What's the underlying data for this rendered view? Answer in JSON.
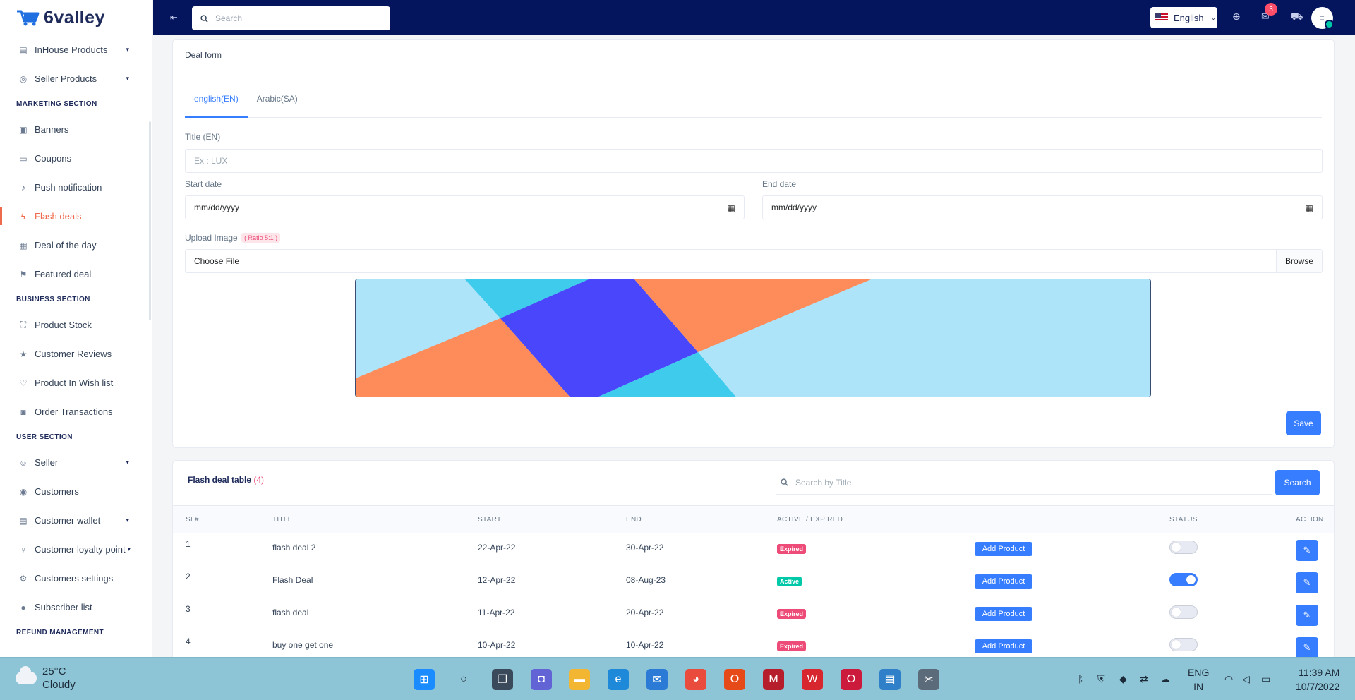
{
  "brand": {
    "name": "6valley"
  },
  "sidebar": {
    "items": [
      {
        "label": "InHouse Products",
        "icon": "store-icon",
        "caret": "▾"
      },
      {
        "label": "Seller Products",
        "icon": "seller-products-icon",
        "caret": "▾"
      },
      {
        "section": "MARKETING SECTION"
      },
      {
        "label": "Banners",
        "icon": "image-icon"
      },
      {
        "label": "Coupons",
        "icon": "coupon-icon"
      },
      {
        "label": "Push notification",
        "icon": "bell-icon"
      },
      {
        "label": "Flash deals",
        "icon": "flash-icon",
        "active": true
      },
      {
        "label": "Deal of the day",
        "icon": "deal-icon"
      },
      {
        "label": "Featured deal",
        "icon": "flag-icon"
      },
      {
        "section": "BUSINESS SECTION"
      },
      {
        "label": "Product Stock",
        "icon": "stock-icon"
      },
      {
        "label": "Customer Reviews",
        "icon": "star-icon"
      },
      {
        "label": "Product In Wish list",
        "icon": "heart-icon"
      },
      {
        "label": "Order Transactions",
        "icon": "money-icon"
      },
      {
        "section": "USER SECTION"
      },
      {
        "label": "Seller",
        "icon": "users-icon",
        "caret": "▾"
      },
      {
        "label": "Customers",
        "icon": "customer-icon"
      },
      {
        "label": "Customer wallet",
        "icon": "wallet-icon",
        "caret": "▾"
      },
      {
        "label": "Customer loyalty point",
        "icon": "bulb-icon",
        "caret": "▾"
      },
      {
        "label": "Customers settings",
        "icon": "gear-icon"
      },
      {
        "label": "Subscriber list",
        "icon": "person-icon"
      },
      {
        "section": "REFUND MANAGEMENT"
      }
    ]
  },
  "topbar": {
    "search_placeholder": "Search",
    "language": "English",
    "message_count": "3"
  },
  "form": {
    "header": "Deal form",
    "tabs": [
      "english(EN)",
      "Arabic(SA)"
    ],
    "title_label": "Title (EN)",
    "title_placeholder": "Ex : LUX",
    "start_label": "Start date",
    "start_value": "mm/dd/yyyy",
    "end_label": "End date",
    "end_value": "mm/dd/yyyy",
    "upload_label": "Upload Image",
    "ratio": "( Ratio 5:1 )",
    "choose_file": "Choose File",
    "browse": "Browse",
    "save": "Save"
  },
  "table": {
    "title": "Flash deal table",
    "count": "(4)",
    "search_placeholder": "Search by Title",
    "search_button": "Search",
    "columns": [
      "SL#",
      "TITLE",
      "START",
      "END",
      "ACTIVE / EXPIRED",
      "STATUS",
      "ACTION"
    ],
    "add_product": "Add Product",
    "rows": [
      {
        "sl": "1",
        "title": "flash deal 2",
        "start": "22-Apr-22",
        "end": "30-Apr-22",
        "state": "Expired",
        "status_on": false
      },
      {
        "sl": "2",
        "title": "Flash Deal",
        "start": "12-Apr-22",
        "end": "08-Aug-23",
        "state": "Active",
        "status_on": true
      },
      {
        "sl": "3",
        "title": "flash deal",
        "start": "11-Apr-22",
        "end": "20-Apr-22",
        "state": "Expired",
        "status_on": false
      },
      {
        "sl": "4",
        "title": "buy one get one",
        "start": "10-Apr-22",
        "end": "10-Apr-22",
        "state": "Expired",
        "status_on": false
      }
    ]
  },
  "taskbar": {
    "temperature": "25°C",
    "weather": "Cloudy",
    "lang_line1": "ENG",
    "lang_line2": "IN",
    "time": "11:39 AM",
    "date": "10/7/2022"
  },
  "colors": {
    "topbar": "#04145d",
    "accent": "#377dff",
    "active_nav": "#ee6c4d",
    "expired": "#ed4c78",
    "active": "#00c9a7"
  }
}
